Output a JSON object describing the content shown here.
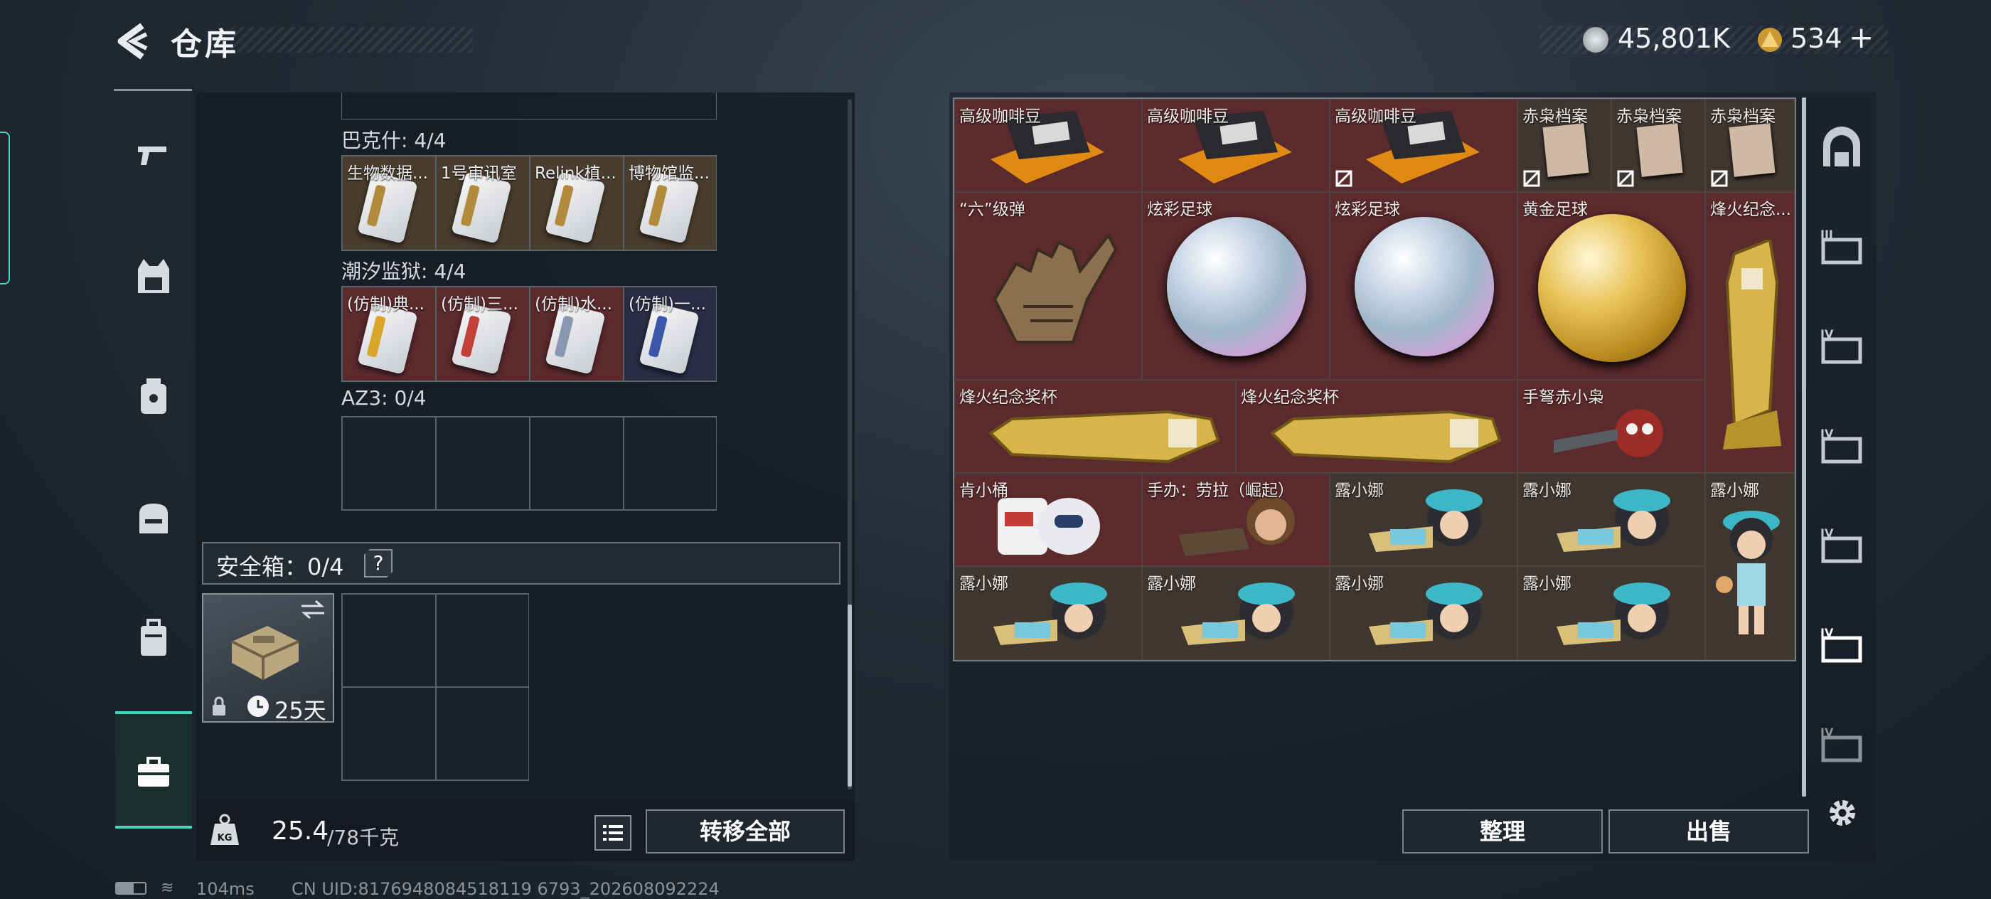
{
  "header": {
    "title": "仓库"
  },
  "currency": [
    {
      "icon": "silver-coin-icon",
      "value": "45,801K"
    },
    {
      "icon": "gold-triangle-coin-icon",
      "value": "534",
      "add": "+"
    }
  ],
  "left_nav": [
    {
      "icon": "gun-icon"
    },
    {
      "icon": "armor-vest-icon"
    },
    {
      "icon": "chest-rig-icon"
    },
    {
      "icon": "backpack-icon"
    },
    {
      "icon": "bag-icon"
    },
    {
      "icon": "toolbox-icon",
      "selected": true
    }
  ],
  "collections": [
    {
      "label": "巴克什: 4/4",
      "items": [
        {
          "name": "生物数据...",
          "stripe": "#b28a3c"
        },
        {
          "name": "1号审讯室",
          "stripe": "#b28a3c"
        },
        {
          "name": "Relink植...",
          "stripe": "#b28a3c"
        },
        {
          "name": "博物馆监...",
          "stripe": "#b28a3c"
        }
      ]
    },
    {
      "label": "潮汐监狱: 4/4",
      "items": [
        {
          "name": "(仿制)典...",
          "stripe": "#d9a52a"
        },
        {
          "name": "(仿制)三...",
          "stripe": "#c2403a"
        },
        {
          "name": "(仿制)水...",
          "stripe": "#8a97b0"
        },
        {
          "name": "(仿制)一...",
          "stripe": "#3b55a8"
        }
      ]
    },
    {
      "label": "AZ3: 0/4",
      "items": []
    }
  ],
  "safe_box": {
    "label": "安全箱：0/4",
    "help": "?",
    "days_left": "25天"
  },
  "weight": {
    "current": "25.4",
    "max": "/78千克"
  },
  "buttons": {
    "transfer_all": "转移全部",
    "sort": "整理",
    "sell": "出售"
  },
  "stash_items": [
    {
      "name": "高级咖啡豆",
      "kind": "coffee",
      "color": "red"
    },
    {
      "name": "高级咖啡豆",
      "kind": "coffee",
      "color": "red"
    },
    {
      "name": "高级咖啡豆",
      "kind": "coffee",
      "color": "red",
      "locked": true
    },
    {
      "name": "赤枭档案",
      "kind": "file",
      "color": "brown",
      "locked": true
    },
    {
      "name": "赤枭档案",
      "kind": "file",
      "color": "brown",
      "locked": true
    },
    {
      "name": "赤枭档案",
      "kind": "file",
      "color": "brown",
      "locked": true
    },
    {
      "name": "“六”级弹",
      "kind": "hand",
      "color": "red"
    },
    {
      "name": "炫彩足球",
      "kind": "ball-rainbow",
      "color": "red"
    },
    {
      "name": "炫彩足球",
      "kind": "ball-rainbow",
      "color": "red"
    },
    {
      "name": "黄金足球",
      "kind": "ball-gold",
      "color": "red"
    },
    {
      "name": "烽火纪念...",
      "kind": "trophy-v",
      "color": "red"
    },
    {
      "name": "烽火纪念奖杯",
      "kind": "trophy-h",
      "color": "red"
    },
    {
      "name": "烽火纪念奖杯",
      "kind": "trophy-h",
      "color": "red"
    },
    {
      "name": "手弩赤小枭",
      "kind": "owl",
      "color": "red"
    },
    {
      "name": "肯小桶",
      "kind": "robot",
      "color": "red"
    },
    {
      "name": "手办：劳拉（崛起）",
      "kind": "figure",
      "color": "red"
    },
    {
      "name": "露小娜",
      "kind": "doll",
      "color": "brown"
    },
    {
      "name": "露小娜",
      "kind": "doll",
      "color": "brown"
    },
    {
      "name": "露小娜",
      "kind": "doll-stand",
      "color": "brown"
    },
    {
      "name": "露小娜",
      "kind": "doll",
      "color": "brown"
    },
    {
      "name": "露小娜",
      "kind": "doll",
      "color": "brown"
    },
    {
      "name": "露小娜",
      "kind": "doll",
      "color": "brown"
    },
    {
      "name": "露小娜",
      "kind": "doll",
      "color": "brown"
    }
  ],
  "right_nav": [
    {
      "icon": "stash-gate-icon"
    },
    {
      "icon": "container-iii-icon",
      "level": "III"
    },
    {
      "icon": "container-iv-icon",
      "level": "IV"
    },
    {
      "icon": "container-iv-icon",
      "level": "IV"
    },
    {
      "icon": "container-iv-icon",
      "level": "IV"
    },
    {
      "icon": "container-iv-icon",
      "level": "IV",
      "selected": true
    },
    {
      "icon": "container-iv-icon",
      "level": "IV"
    },
    {
      "icon": "settings-gear-icon"
    }
  ],
  "status_bar": {
    "ping": "104ms",
    "uid": "CN UID:8176948084518119 6793_202608092224"
  }
}
